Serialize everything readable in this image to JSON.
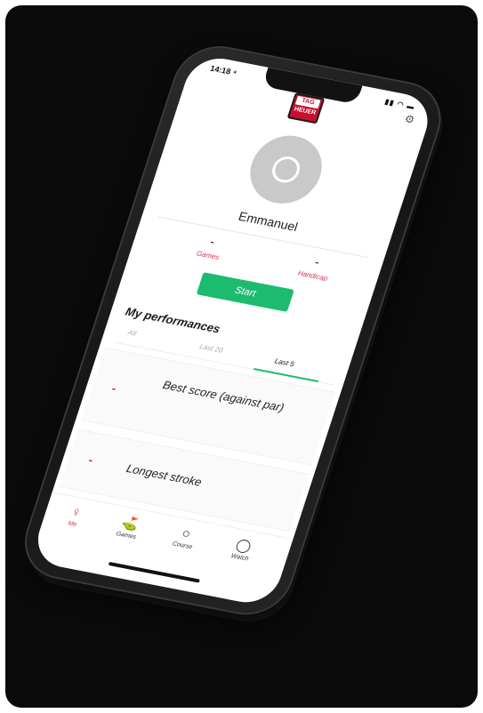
{
  "status": {
    "time": "14:18 ⁴",
    "icons": "▮▮ ◠ ▬"
  },
  "brand": {
    "logo_top": "TAG",
    "logo_bottom": "HEUER"
  },
  "profile": {
    "name": "Emmanuel"
  },
  "stats": {
    "games": {
      "value": "-",
      "label": "Games"
    },
    "handicap": {
      "value": "-",
      "label": "Handicap"
    }
  },
  "start_label": "Start",
  "performances": {
    "title": "My performances",
    "tabs": [
      "All",
      "Last 20",
      "Last 5"
    ],
    "selected_tab": "Last 5",
    "cards": [
      {
        "value": "-",
        "label": "Best score (against par)"
      },
      {
        "value": "-",
        "label": "Longest stroke"
      }
    ]
  },
  "nav": {
    "items": [
      {
        "label": "Me",
        "icon": "person-icon"
      },
      {
        "label": "Games",
        "icon": "golf-flag-icon"
      },
      {
        "label": "Course",
        "icon": "search-icon"
      },
      {
        "label": "Watch",
        "icon": "watch-icon"
      }
    ]
  },
  "colors": {
    "accent_green": "#1dbb6e",
    "accent_red": "#e0314b",
    "background": "#0b0b0b"
  }
}
